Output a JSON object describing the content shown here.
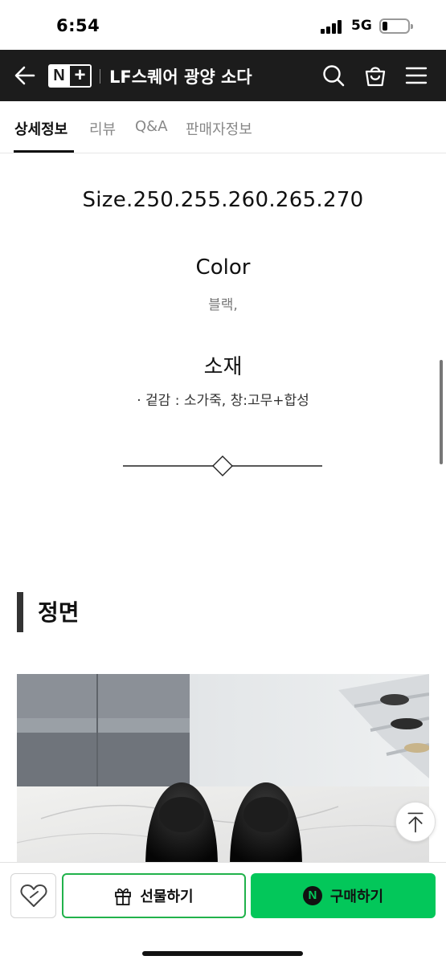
{
  "status_bar": {
    "time": "6:54",
    "network": "5G",
    "battery_level": 0.2
  },
  "header": {
    "logo_n": "N",
    "logo_plus": "+",
    "store_title": "LF스퀘어 광양 소다",
    "icons": [
      "back-arrow-icon",
      "search-icon",
      "shopping-bag-icon",
      "menu-icon"
    ]
  },
  "tabs": [
    {
      "label": "상세정보",
      "active": true
    },
    {
      "label": "리뷰",
      "active": false
    },
    {
      "label": "Q&A",
      "active": false
    },
    {
      "label": "판매자정보",
      "active": false
    }
  ],
  "details": {
    "size_line": "Size.250.255.260.265.270",
    "color_heading": "Color",
    "color_value": "블랙,",
    "material_heading": "소재",
    "material_value": "· 겉감 : 소가죽, 창:고무+합성"
  },
  "section": {
    "title": "정면"
  },
  "bottom_bar": {
    "gift_label": "선물하기",
    "buy_label": "구매하기",
    "npay_letter": "N"
  },
  "colors": {
    "header_bg": "#1c1c1c",
    "accent_green": "#03c75a",
    "gift_border": "#21b24b"
  }
}
